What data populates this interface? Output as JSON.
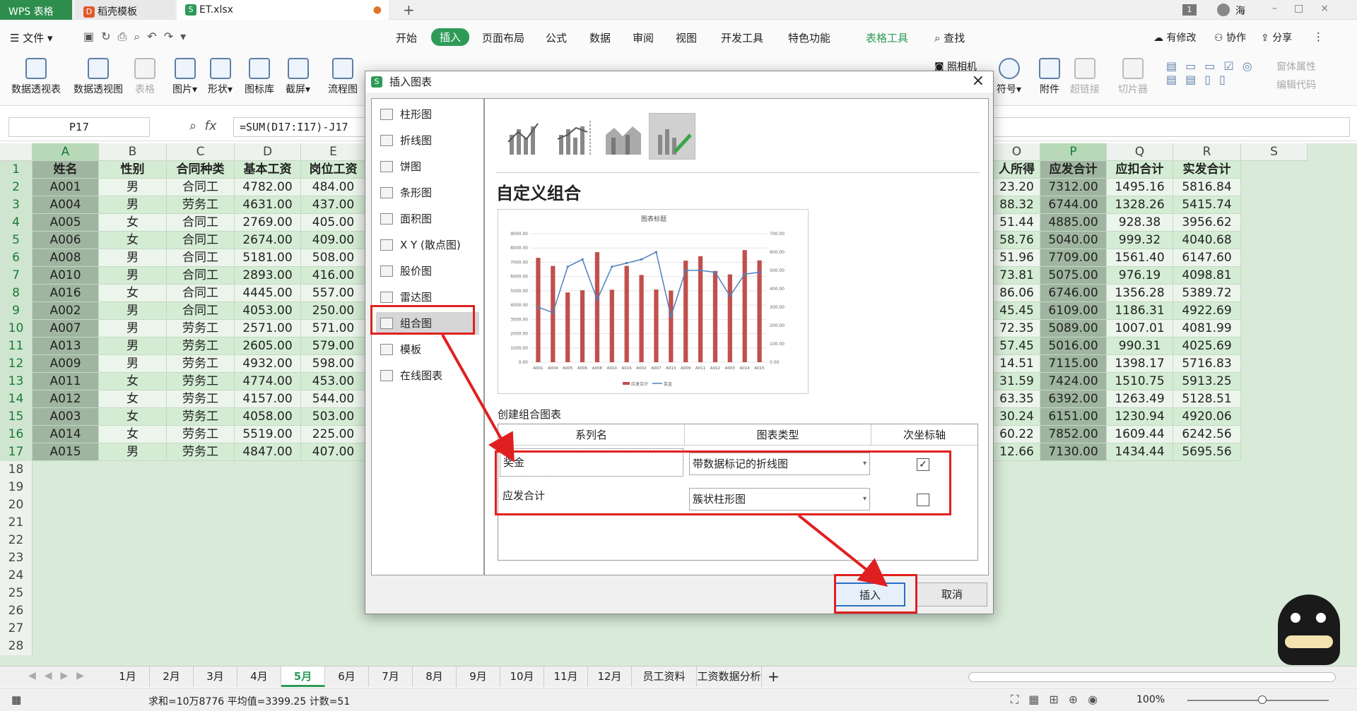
{
  "titlebar": {
    "tabs": [
      {
        "label": "WPS 表格"
      },
      {
        "label": "稻壳模板"
      },
      {
        "label": "ET.xlsx"
      }
    ],
    "user": "海",
    "badge": "1"
  },
  "menu": {
    "file": "文件",
    "items": [
      "开始",
      "插入",
      "页面布局",
      "公式",
      "数据",
      "审阅",
      "视图",
      "开发工具",
      "特色功能",
      "表格工具"
    ],
    "active": "插入",
    "search": "查找",
    "right": [
      "有修改",
      "协作",
      "分享"
    ]
  },
  "ribbon": {
    "left": [
      "数据透视表",
      "数据透视图",
      "表格",
      "图片",
      "形状",
      "图标库",
      "截屏",
      "流程图"
    ],
    "right": [
      "照相机",
      "符号",
      "附件",
      "超链接",
      "切片器",
      "窗体属性",
      "编辑代码"
    ]
  },
  "formula": {
    "namebox": "P17",
    "fx": "fx",
    "value": "=SUM(D17:I17)-J17"
  },
  "sheet": {
    "columns_left": [
      "A",
      "B",
      "C",
      "D",
      "E"
    ],
    "columns_right": [
      "O",
      "P",
      "Q",
      "R",
      "S"
    ],
    "headers_left": [
      "姓名",
      "性别",
      "合同种类",
      "基本工资",
      "岗位工资"
    ],
    "headers_right": [
      "人所得",
      "应发合计",
      "应扣合计",
      "实发合计"
    ],
    "rows_left": [
      [
        "A001",
        "男",
        "合同工",
        "4782.00",
        "484.00"
      ],
      [
        "A004",
        "男",
        "劳务工",
        "4631.00",
        "437.00"
      ],
      [
        "A005",
        "女",
        "合同工",
        "2769.00",
        "405.00"
      ],
      [
        "A006",
        "女",
        "合同工",
        "2674.00",
        "409.00"
      ],
      [
        "A008",
        "男",
        "合同工",
        "5181.00",
        "508.00"
      ],
      [
        "A010",
        "男",
        "合同工",
        "2893.00",
        "416.00"
      ],
      [
        "A016",
        "女",
        "合同工",
        "4445.00",
        "557.00"
      ],
      [
        "A002",
        "男",
        "合同工",
        "4053.00",
        "250.00"
      ],
      [
        "A007",
        "男",
        "劳务工",
        "2571.00",
        "571.00"
      ],
      [
        "A013",
        "男",
        "劳务工",
        "2605.00",
        "579.00"
      ],
      [
        "A009",
        "男",
        "劳务工",
        "4932.00",
        "598.00"
      ],
      [
        "A011",
        "女",
        "劳务工",
        "4774.00",
        "453.00"
      ],
      [
        "A012",
        "女",
        "劳务工",
        "4157.00",
        "544.00"
      ],
      [
        "A003",
        "女",
        "劳务工",
        "4058.00",
        "503.00"
      ],
      [
        "A014",
        "女",
        "劳务工",
        "5519.00",
        "225.00"
      ],
      [
        "A015",
        "男",
        "劳务工",
        "4847.00",
        "407.00"
      ]
    ],
    "rows_right": [
      [
        "23.20",
        "7312.00",
        "1495.16",
        "5816.84"
      ],
      [
        "88.32",
        "6744.00",
        "1328.26",
        "5415.74"
      ],
      [
        "51.44",
        "4885.00",
        "928.38",
        "3956.62"
      ],
      [
        "58.76",
        "5040.00",
        "999.32",
        "4040.68"
      ],
      [
        "51.96",
        "7709.00",
        "1561.40",
        "6147.60"
      ],
      [
        "73.81",
        "5075.00",
        "976.19",
        "4098.81"
      ],
      [
        "86.06",
        "6746.00",
        "1356.28",
        "5389.72"
      ],
      [
        "45.45",
        "6109.00",
        "1186.31",
        "4922.69"
      ],
      [
        "72.35",
        "5089.00",
        "1007.01",
        "4081.99"
      ],
      [
        "57.45",
        "5016.00",
        "990.31",
        "4025.69"
      ],
      [
        "14.51",
        "7115.00",
        "1398.17",
        "5716.83"
      ],
      [
        "31.59",
        "7424.00",
        "1510.75",
        "5913.25"
      ],
      [
        "63.35",
        "6392.00",
        "1263.49",
        "5128.51"
      ],
      [
        "30.24",
        "6151.00",
        "1230.94",
        "4920.06"
      ],
      [
        "60.22",
        "7852.00",
        "1609.44",
        "6242.56"
      ],
      [
        "12.66",
        "7130.00",
        "1434.44",
        "5695.56"
      ]
    ],
    "row_numbers": [
      "1",
      "2",
      "3",
      "4",
      "5",
      "6",
      "7",
      "8",
      "9",
      "10",
      "11",
      "12",
      "13",
      "14",
      "15",
      "16",
      "17",
      "18",
      "19",
      "20",
      "21",
      "22",
      "23",
      "24",
      "25",
      "26",
      "27",
      "28"
    ]
  },
  "sheettabs": [
    "1月",
    "2月",
    "3月",
    "4月",
    "5月",
    "6月",
    "7月",
    "8月",
    "9月",
    "10月",
    "11月",
    "12月",
    "员工资料",
    "工资数据分析"
  ],
  "active_sheet": "5月",
  "status": {
    "summary": "求和=10万8776  平均值=3399.25  计数=51",
    "zoom": "100%"
  },
  "dialog": {
    "title": "插入图表",
    "chart_types": [
      "柱形图",
      "折线图",
      "饼图",
      "条形图",
      "面积图",
      "X Y (散点图)",
      "股价图",
      "雷达图",
      "组合图",
      "模板",
      "在线图表"
    ],
    "selected_type": "组合图",
    "heading": "自定义组合",
    "create_label": "创建组合图表",
    "table_headers": [
      "系列名",
      "图表类型",
      "次坐标轴"
    ],
    "series_rows": [
      {
        "name": "奖金",
        "type": "带数据标记的折线图",
        "secondary": true
      },
      {
        "name": "应发合计",
        "type": "簇状柱形图",
        "secondary": false
      }
    ],
    "insert": "插入",
    "cancel": "取消",
    "close": "×"
  },
  "chart_data": {
    "type": "bar",
    "title": "图表标题",
    "categories": [
      "A001",
      "A004",
      "A005",
      "A006",
      "A008",
      "A010",
      "A016",
      "A002",
      "A007",
      "A013",
      "A009",
      "A011",
      "A012",
      "A003",
      "A014",
      "A015"
    ],
    "series": [
      {
        "name": "应发合计",
        "type": "bar",
        "color": "#c0504d",
        "values": [
          7312,
          6744,
          4885,
          5040,
          7709,
          5075,
          6746,
          6109,
          5089,
          5016,
          7115,
          7424,
          6392,
          6151,
          7852,
          7130
        ]
      },
      {
        "name": "奖金",
        "type": "line",
        "color": "#4f81bd",
        "axis": "secondary",
        "values": [
          300,
          270,
          520,
          560,
          340,
          520,
          540,
          560,
          600,
          250,
          500,
          500,
          490,
          360,
          480,
          490
        ]
      }
    ],
    "ylim": [
      0,
      9000
    ],
    "y2lim": [
      0,
      700
    ],
    "yticks": [
      "0.00",
      "1000.00",
      "2000.00",
      "3000.00",
      "4000.00",
      "5000.00",
      "6000.00",
      "7000.00",
      "8000.00",
      "9000.00"
    ],
    "y2ticks": [
      "0.00",
      "100.00",
      "200.00",
      "300.00",
      "400.00",
      "500.00",
      "600.00",
      "700.00"
    ],
    "legend": "bottom"
  }
}
